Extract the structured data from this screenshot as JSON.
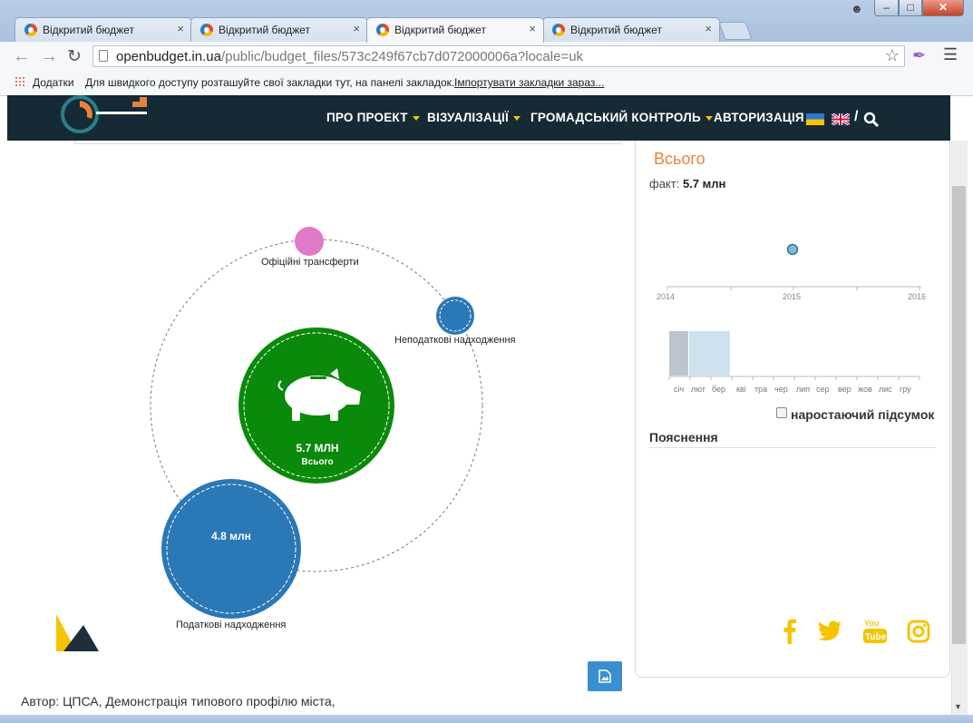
{
  "browser": {
    "tabs": [
      {
        "label": "Відкритий бюджет",
        "active": false
      },
      {
        "label": "Відкритий бюджет",
        "active": false
      },
      {
        "label": "Відкритий бюджет",
        "active": true
      },
      {
        "label": "Відкритий бюджет",
        "active": false
      }
    ],
    "tab_close": "×",
    "url_host": "openbudget.in.ua",
    "url_path": "/public/budget_files/573c249f67cb7d072000006a?locale=uk",
    "bookmarks": {
      "apps_label": "Додатки",
      "hint": "Для швидкого доступу розташуйте свої закладки тут, на панелі закладок.",
      "import_link": "Імпортувати закладки зараз..."
    }
  },
  "site_nav": {
    "items": [
      "ПРО ПРОЕКТ",
      "ВІЗУАЛІЗАЦІЇ",
      "ГРОМАДСЬКИЙ КОНТРОЛЬ",
      "АВТОРИЗАЦІЯ"
    ],
    "separator": "/"
  },
  "bubbles": {
    "center": {
      "value": "5.7 МЛН",
      "label": "Всього",
      "color": "#0a8a0a"
    },
    "official_transfers": {
      "label": "Офіційні трансферти",
      "color": "#e07ac8"
    },
    "non_tax": {
      "label": "Неподаткові надходження",
      "color": "#2a78b6"
    },
    "tax": {
      "value": "4.8 млн",
      "label": "Податкові надходження",
      "color": "#2a78b6"
    }
  },
  "panel": {
    "title": "Всього",
    "fact_label": "факт:",
    "fact_value": "5.7 млн",
    "year_ticks": [
      "2014",
      "2015",
      "2016"
    ],
    "month_ticks": [
      "січ",
      "лют",
      "бер",
      "кві",
      "тра",
      "чер",
      "лип",
      "сер",
      "вер",
      "жов",
      "лис",
      "гру"
    ],
    "cumulative_label": "наростаючий підсумок",
    "notes_title": "Пояснення"
  },
  "footer": {
    "author": "Автор: ЦПСА, Демонстрація типового профілю міста,"
  },
  "colors": {
    "nav_bg": "#162a36",
    "accent_yellow": "#f5c400",
    "panel_title": "#e8833a",
    "point": "#7fb8de"
  },
  "icons": [
    "piggy-bank-icon",
    "search-icon",
    "image-download-icon",
    "facebook-icon",
    "twitter-icon",
    "youtube-icon",
    "instagram-icon"
  ]
}
